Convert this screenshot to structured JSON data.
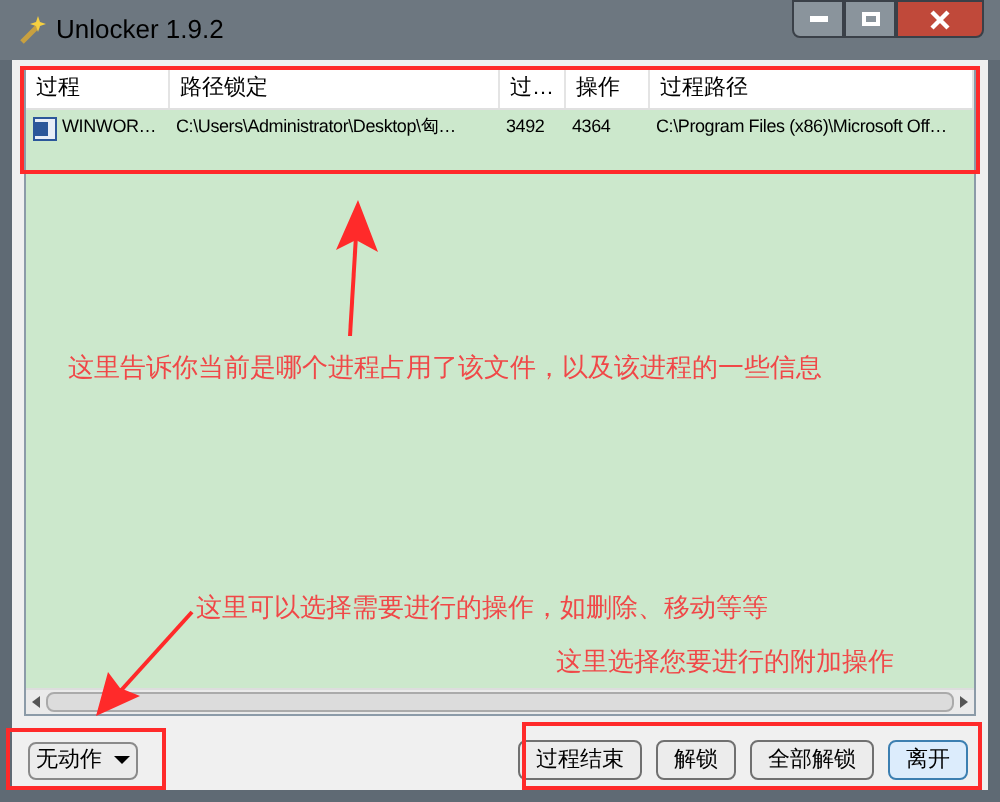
{
  "window": {
    "title": "Unlocker 1.9.2"
  },
  "table": {
    "columns": [
      "过程",
      "路径锁定",
      "过…",
      "操作",
      "过程路径"
    ],
    "rows": [
      {
        "cells": [
          "WINWOR…",
          "C:\\Users\\Administrator\\Desktop\\匈…",
          "3492",
          "4364",
          "C:\\Program Files (x86)\\Microsoft Off…"
        ],
        "selected": false
      }
    ]
  },
  "action_dropdown": {
    "value": "无动作"
  },
  "buttons": [
    {
      "label": "过程结束",
      "selected": false
    },
    {
      "label": "解锁",
      "selected": false
    },
    {
      "label": "全部解锁",
      "selected": false
    },
    {
      "label": "离开",
      "selected": true
    }
  ],
  "annotations": [
    "这里告诉你当前是哪个进程占用了该文件，以及该进程的一些信息",
    "这里可以选择需要进行的操作，如删除、移动等等",
    "这里选择您要进行的附加操作"
  ]
}
